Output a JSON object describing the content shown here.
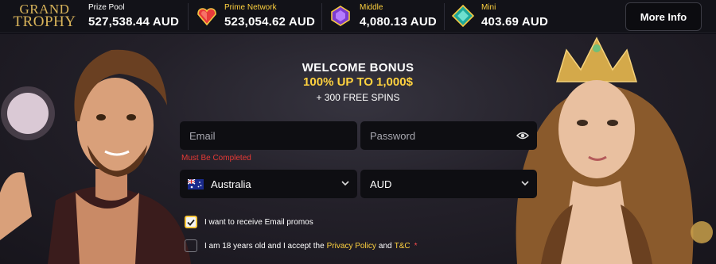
{
  "logo": {
    "line1": "GRAND",
    "line2": "TROPHY"
  },
  "jackpots": [
    {
      "label": "Prize Pool",
      "value": "527,538.44 AUD",
      "label_color": "#ffffff",
      "icon": "none"
    },
    {
      "label": "Prime Network",
      "value": "523,054.62 AUD",
      "label_color": "#ffd23f",
      "icon": "red-heart-gem-icon"
    },
    {
      "label": "Middle",
      "value": "4,080.13 AUD",
      "label_color": "#ffd23f",
      "icon": "purple-gem-icon"
    },
    {
      "label": "Mini",
      "value": "403.69 AUD",
      "label_color": "#ffd23f",
      "icon": "teal-gem-icon"
    }
  ],
  "more_info_label": "More Info",
  "bonus": {
    "line1": "WELCOME BONUS",
    "line2": "100% UP TO 1,000$",
    "line3": "+ 300 FREE SPINS"
  },
  "form": {
    "email_placeholder": "Email",
    "password_placeholder": "Password",
    "email_error": "Must Be Completed",
    "country": "Australia",
    "currency": "AUD",
    "promo_label": "I want to receive Email promos",
    "promo_checked": true,
    "terms_prefix": "I am 18 years old and I accept the",
    "privacy_link": "Privacy Policy",
    "and_word": "and",
    "tc_link": "T&C",
    "required_mark": "*",
    "terms_checked": false
  },
  "colors": {
    "accent": "#ffd23f",
    "error": "#e53935",
    "logo": "#d9b45a"
  }
}
